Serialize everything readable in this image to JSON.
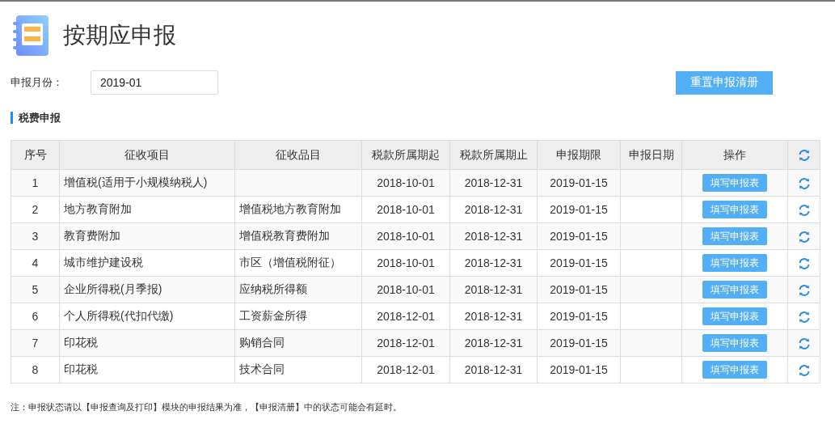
{
  "page": {
    "title": "按期应申报"
  },
  "month_field": {
    "label": "申报月份：",
    "value": "2019-01"
  },
  "reset_button": "重置申报清册",
  "section_title": "税费申报",
  "table": {
    "columns": [
      "序号",
      "征收项目",
      "征收品目",
      "税款所属期起",
      "税款所属期止",
      "申报期限",
      "申报日期",
      "操作"
    ],
    "rows": [
      {
        "no": "1",
        "item": "增值税(适用于小规模纳税人)",
        "category": "",
        "start": "2018-10-01",
        "end": "2018-12-31",
        "deadline": "2019-01-15",
        "date": "",
        "action": "填写申报表"
      },
      {
        "no": "2",
        "item": "地方教育附加",
        "category": "增值税地方教育附加",
        "start": "2018-10-01",
        "end": "2018-12-31",
        "deadline": "2019-01-15",
        "date": "",
        "action": "填写申报表"
      },
      {
        "no": "3",
        "item": "教育费附加",
        "category": "增值税教育费附加",
        "start": "2018-10-01",
        "end": "2018-12-31",
        "deadline": "2019-01-15",
        "date": "",
        "action": "填写申报表"
      },
      {
        "no": "4",
        "item": "城市维护建设税",
        "category": "市区（增值税附征）",
        "start": "2018-10-01",
        "end": "2018-12-31",
        "deadline": "2019-01-15",
        "date": "",
        "action": "填写申报表"
      },
      {
        "no": "5",
        "item": "企业所得税(月季报)",
        "category": "应纳税所得额",
        "start": "2018-10-01",
        "end": "2018-12-31",
        "deadline": "2019-01-15",
        "date": "",
        "action": "填写申报表"
      },
      {
        "no": "6",
        "item": "个人所得税(代扣代缴)",
        "category": "工资薪金所得",
        "start": "2018-12-01",
        "end": "2018-12-31",
        "deadline": "2019-01-15",
        "date": "",
        "action": "填写申报表"
      },
      {
        "no": "7",
        "item": "印花税",
        "category": "购销合同",
        "start": "2018-12-01",
        "end": "2018-12-31",
        "deadline": "2019-01-15",
        "date": "",
        "action": "填写申报表"
      },
      {
        "no": "8",
        "item": "印花税",
        "category": "技术合同",
        "start": "2018-12-01",
        "end": "2018-12-31",
        "deadline": "2019-01-15",
        "date": "",
        "action": "填写申报表"
      }
    ]
  },
  "note": "注：申报状态请以【申报查询及打印】模块的申报结果为准，【申报清册】中的状态可能会有延时。"
}
